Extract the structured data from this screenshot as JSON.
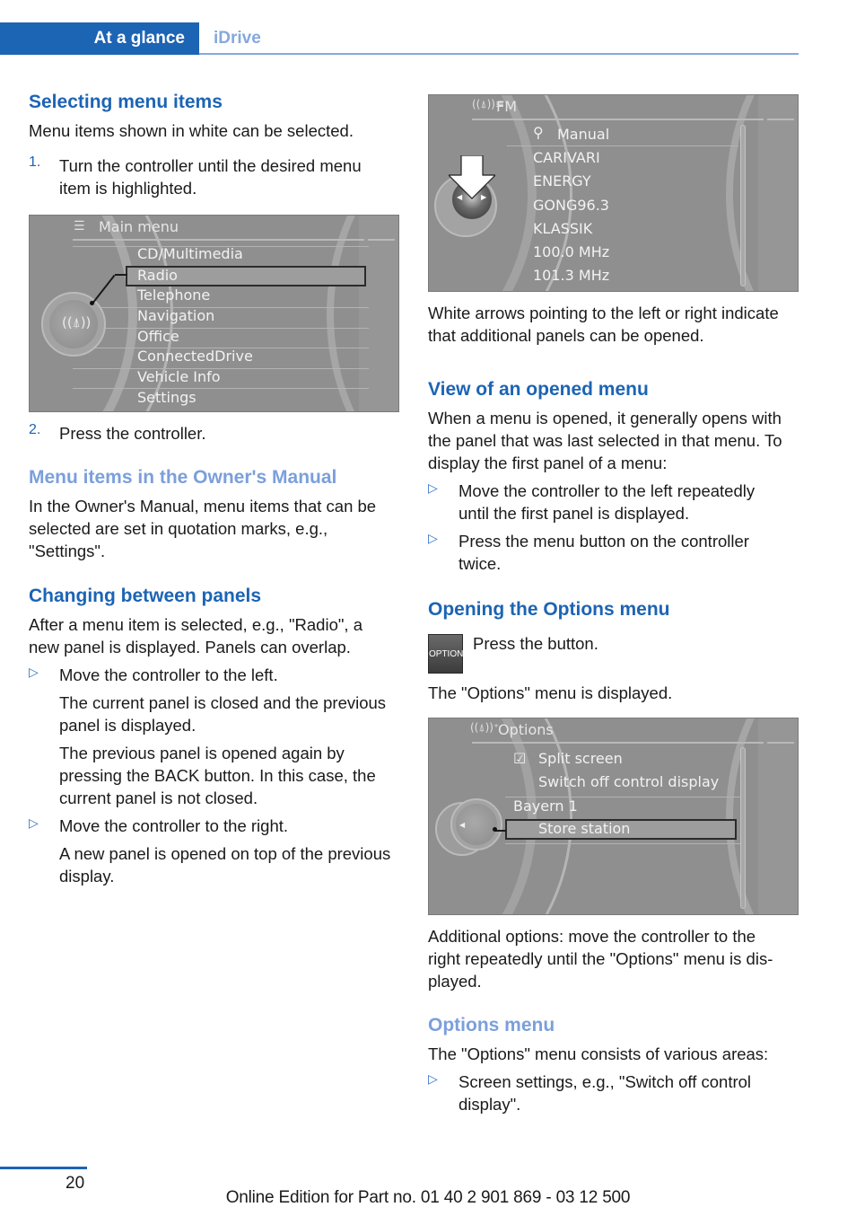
{
  "header": {
    "section_tab": "At a glance",
    "chapter_tab": "iDrive"
  },
  "left": {
    "selecting": {
      "heading": "Selecting menu items",
      "intro": "Menu items shown in white can be selected.",
      "step1_num": "1.",
      "step1_line1": "Turn the controller until the desired menu",
      "step1_line2": "item is highlighted.",
      "step2_num": "2.",
      "step2": "Press the controller."
    },
    "main_menu_screen": {
      "title": "Main menu",
      "items": [
        "CD/Multimedia",
        "Radio",
        "Telephone",
        "Navigation",
        "Office",
        "ConnectedDrive",
        "Vehicle Info",
        "Settings"
      ],
      "highlighted": "Radio"
    },
    "owners_manual": {
      "heading": "Menu items in the Owner's Manual",
      "line1": "In the Owner's Manual, menu items that can be",
      "line2": "selected are set in quotation marks, e.g.,",
      "line3": "\"Settings\"."
    },
    "changing": {
      "heading": "Changing between panels",
      "line1": "After a menu item is selected, e.g., \"Radio\", a",
      "line2": "new panel is displayed. Panels can overlap.",
      "bullet_glyph": "▷",
      "b1": "Move the controller to the left.",
      "b1_sub1_l1": "The current panel is closed and the previous",
      "b1_sub1_l2": "panel is displayed.",
      "b1_sub2_l1": "The previous panel is opened again by",
      "b1_sub2_l2": "pressing the BACK button. In this case, the",
      "b1_sub2_l3": "current panel is not closed.",
      "b2": "Move the controller to the right.",
      "b2_sub_l1": "A new panel is opened on top of the previous",
      "b2_sub_l2": "display."
    }
  },
  "right": {
    "fm_screen": {
      "title": "FM",
      "search_item": "Manual",
      "stations": [
        "CARIVARI",
        "ENERGY",
        "GONG96.3",
        "KLASSIK",
        "100.0  MHz",
        "101.3  MHz"
      ]
    },
    "arrows_text_l1": "White arrows pointing to the left or right indicate",
    "arrows_text_l2": "that additional panels can be opened.",
    "opened": {
      "heading": "View of an opened menu",
      "l1": "When a menu is opened, it generally opens with",
      "l2": "the panel that was last selected in that menu. To",
      "l3": "display the first panel of a menu:",
      "b1_l1": "Move the controller to the left repeatedly",
      "b1_l2": "until the first panel is displayed.",
      "b2_l1": "Press the menu button on the controller",
      "b2_l2": "twice."
    },
    "options_open": {
      "heading": "Opening the Options menu",
      "button_label": "OPTION",
      "press_text": "Press the button.",
      "displayed_text": "The \"Options\" menu is displayed."
    },
    "options_screen": {
      "title": "Options",
      "items": [
        "Split screen",
        "Switch off control display"
      ],
      "section": "Bayern 1",
      "highlighted": "Store station"
    },
    "additional_l1": "Additional options: move the controller to the",
    "additional_l2": "right repeatedly until the \"Options\" menu is dis-",
    "additional_l3": "played.",
    "options_menu": {
      "heading": "Options menu",
      "intro": "The \"Options\" menu consists of various areas:",
      "b1_l1": "Screen settings, e.g., \"Switch off control",
      "b1_l2": "display\"."
    }
  },
  "footer": {
    "page_number": "20",
    "edition": "Online Edition for Part no. 01 40 2 901 869 - 03 12 500"
  },
  "colors": {
    "accent_blue": "#1c64b4",
    "light_blue": "#7b9fdc",
    "screen_gray": "#8f8f8f"
  }
}
